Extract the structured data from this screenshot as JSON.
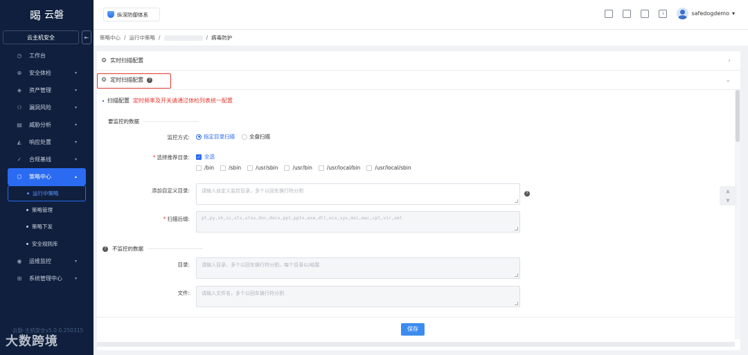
{
  "sidebar": {
    "logo_glyph": "暍",
    "logo_text": "云磐",
    "scope_label": "云主机安全",
    "collapse_icon": "collapse-icon",
    "menu": [
      {
        "label": "工作台",
        "icon": "dashboard-icon",
        "glyph": "◷"
      },
      {
        "label": "安全体检",
        "icon": "checkup-icon",
        "glyph": "⊕",
        "arrow": "▾"
      },
      {
        "label": "资产管理",
        "icon": "asset-icon",
        "glyph": "◈",
        "arrow": "▾"
      },
      {
        "label": "漏洞风险",
        "icon": "bug-icon",
        "glyph": "⚇",
        "arrow": "▾"
      },
      {
        "label": "威胁分析",
        "icon": "threat-icon",
        "glyph": "▤",
        "arrow": "▾"
      },
      {
        "label": "响应处置",
        "icon": "response-icon",
        "glyph": "◭",
        "arrow": "▾"
      },
      {
        "label": "合规基线",
        "icon": "baseline-icon",
        "glyph": "✓",
        "arrow": "▾"
      },
      {
        "label": "策略中心",
        "icon": "policy-icon",
        "glyph": "⬡",
        "arrow": "▴"
      }
    ],
    "submenu": [
      "运行中策略",
      "策略管理",
      "策略下发",
      "安全规则库"
    ],
    "menu_after": [
      {
        "label": "运维监控",
        "icon": "monitor-icon",
        "glyph": "◉",
        "arrow": "▾"
      },
      {
        "label": "系统管理中心",
        "icon": "system-icon",
        "glyph": "⊞",
        "arrow": "▾"
      }
    ],
    "version": "云磐-主机安全v5.0.0.250315",
    "watermark": "大数跨境"
  },
  "topbar": {
    "brand_chip": "纵深防御体系",
    "username": "safedogdemo",
    "user_caret": "▾"
  },
  "breadcrumb": {
    "items": [
      "策略中心",
      "运行中策略"
    ],
    "current": "病毒防护",
    "sep": "/"
  },
  "main": {
    "acc_realtime": "实时扫描配置",
    "acc_scheduled": "定时扫描配置",
    "acc_icon": "⚙",
    "chev_right": "›",
    "chev_down": "⌄",
    "help_mark": "?",
    "section_title": "扫描配置",
    "section_tip": "定时频率及开关请通过体检列表统一配置",
    "group_monitored": "要监控的数据",
    "label_mode": "监控方式:",
    "mode_options": [
      "指定目录扫描",
      "全盘扫描"
    ],
    "label_dirs": "选择推荐目录:",
    "select_all": "全选",
    "dirs": [
      "/bin",
      "/sbin",
      "/usr/sbin",
      "/usr/bin",
      "/usr/local/bin",
      "/usr/local/sbin"
    ],
    "label_custom_dir": "添加自定义目录:",
    "custom_dir_placeholder": "请输入自定义监控目录，多个以回车换行符分割",
    "label_suffix": "扫描后缀:",
    "suffix_value": "pl,py,sh,cc,xls,xlsx,doc,docx,ppt,pptx,exe,dll,ocx,sys,msi,mac,cpl,vir,xml",
    "group_unmonitored": "不监控的数据",
    "label_dir": "目录:",
    "dir_placeholder": "请输入目录，多个以回车换行符分割，每个目录以/结尾",
    "label_file": "文件:",
    "file_placeholder": "请输入文件名，多个以回车换行符分割",
    "save_label": "保存",
    "side_up": "▲",
    "side_down": "▼"
  }
}
